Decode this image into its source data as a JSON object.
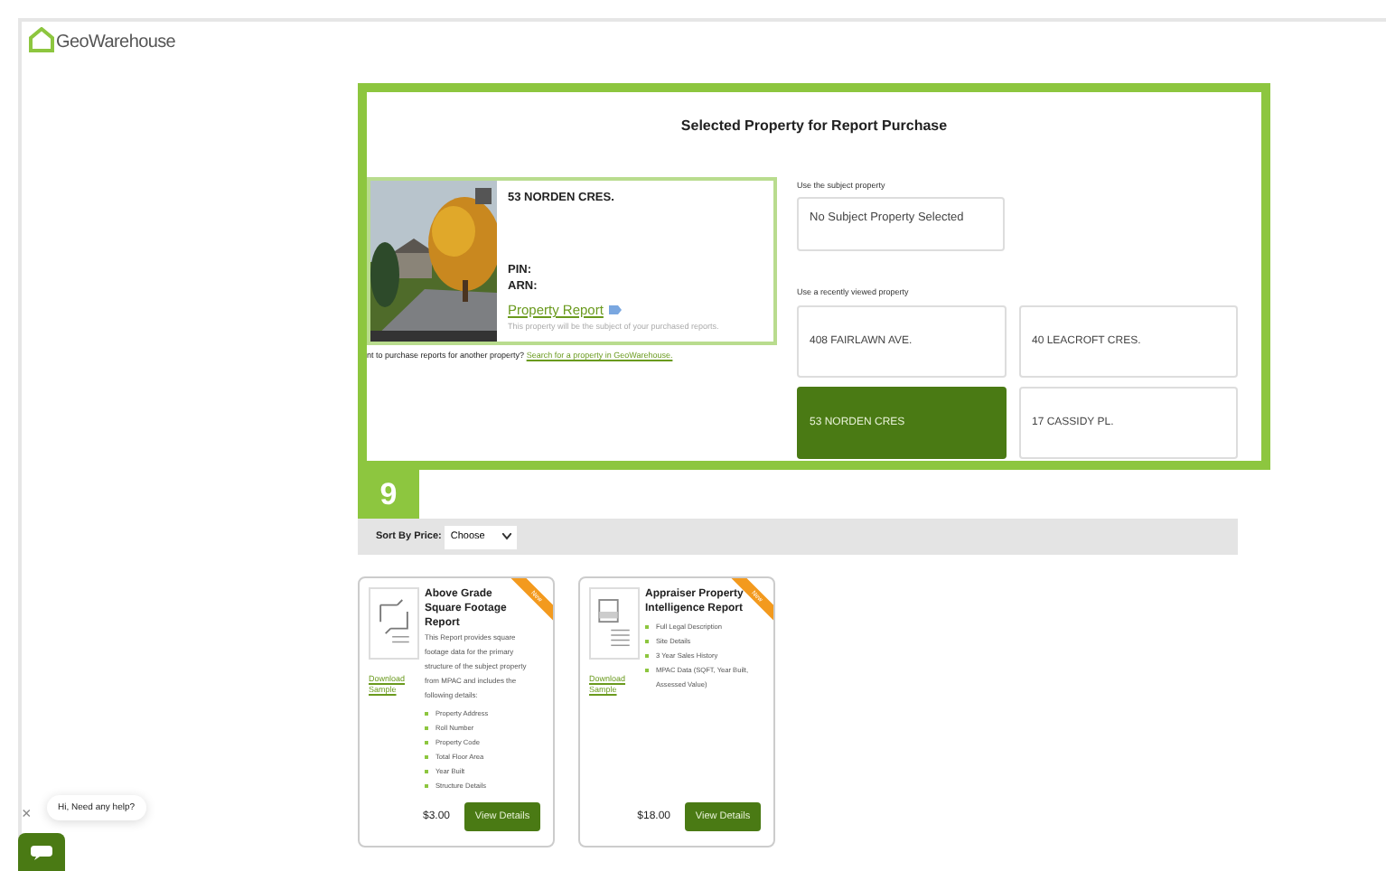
{
  "logo": {
    "name": "GeoWarehouse"
  },
  "panel": {
    "title": "Selected Property for Report Purchase",
    "property": {
      "address": "53 NORDEN CRES.",
      "pin_label": "PIN:",
      "arn_label": "ARN:",
      "report_link": "Property Report",
      "note": "This property will be the subject of your purchased reports."
    },
    "another": {
      "text": "nt to purchase reports for another property?",
      "link": "Search for a property in GeoWarehouse."
    },
    "subject": {
      "label": "Use the subject property",
      "value": "No Subject Property Selected"
    },
    "recent": {
      "label": "Use a recently viewed property",
      "items": [
        {
          "address": "408 FAIRLAWN AVE.",
          "selected": false
        },
        {
          "address": "40 LEACROFT CRES.",
          "selected": false
        },
        {
          "address": "53 NORDEN CRES",
          "selected": true
        },
        {
          "address": "17 CASSIDY PL.",
          "selected": false
        }
      ]
    }
  },
  "step_badge": "9",
  "sort": {
    "label": "Sort By Price:",
    "value": "Choose"
  },
  "reports": [
    {
      "kind": "footage",
      "title": "Above Grade Square Footage Report",
      "ribbon": "New",
      "description": "This Report provides square footage data for the primary structure of the subject property from MPAC and includes the following details:",
      "features": [
        "Property Address",
        "Roll Number",
        "Property Code",
        "Total Floor Area",
        "Year Built",
        "Structure Details"
      ],
      "download": "Download Sample",
      "price": "$3.00",
      "button": "View Details"
    },
    {
      "kind": "appraisal",
      "title": "Appraiser Property Intelligence Report",
      "ribbon": "New",
      "features": [
        "Full Legal Description",
        "Site Details",
        "3 Year Sales History",
        "MPAC Data (SQFT, Year Built, Assessed Value)"
      ],
      "download": "Download Sample",
      "price": "$18.00",
      "button": "View Details"
    }
  ],
  "chat": {
    "close": "×",
    "message": "Hi, Need any help?"
  }
}
